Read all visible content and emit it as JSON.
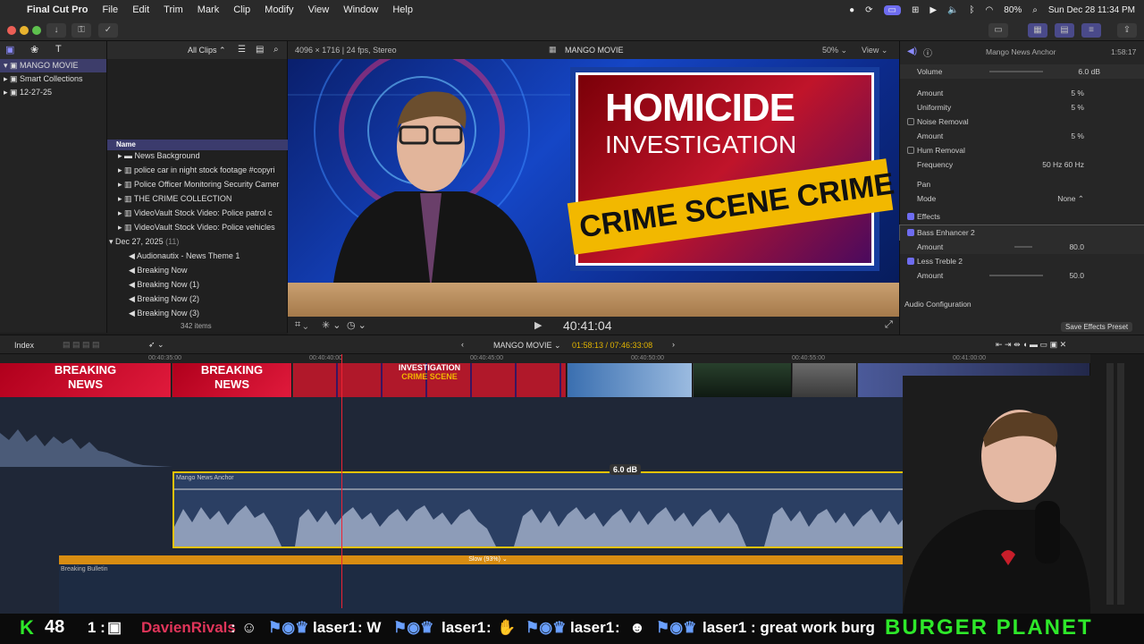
{
  "menubar": {
    "app_name": "Final Cut Pro",
    "items": [
      "File",
      "Edit",
      "Trim",
      "Mark",
      "Clip",
      "Modify",
      "View",
      "Window",
      "Help"
    ],
    "battery": "80%",
    "datetime": "Sun Dec 28  11:34 PM"
  },
  "library": {
    "items": [
      {
        "label": "MANGO MOVIE"
      },
      {
        "label": "Smart Collections"
      },
      {
        "label": "12-27-25"
      }
    ]
  },
  "browser": {
    "filter": "All Clips",
    "column_name": "Name",
    "rows": [
      {
        "label": "News Background"
      },
      {
        "label": "police  car in night stock footage #copyri"
      },
      {
        "label": "Police Officer Monitoring Security Camer"
      },
      {
        "label": "THE CRIME COLLECTION"
      },
      {
        "label": "VideoVault Stock Video:   Police patrol c"
      },
      {
        "label": "VideoVault Stock Video:   Police vehicles"
      },
      {
        "label": "Dec 27, 2025"
      },
      {
        "label": "Audionautix - News Theme 1"
      },
      {
        "label": "Breaking Now"
      },
      {
        "label": "Breaking Now (1)"
      },
      {
        "label": "Breaking Now (2)"
      },
      {
        "label": "Breaking Now (3)"
      }
    ],
    "date_count": "(11)",
    "items_count": "342 items"
  },
  "viewer": {
    "format": "4096 × 1716 | 24 fps, Stereo",
    "title": "MANGO MOVIE",
    "zoom": "50%",
    "view_label": "View",
    "timecode": "40:41:04",
    "card_line1": "HOMICIDE",
    "card_line2": "INVESTIGATION",
    "tape_text": "CRIME SCENE  CRIME SCENE"
  },
  "inspector": {
    "clip_name": "Mango News Anchor",
    "duration": "1:58:17",
    "volume_label": "Volume",
    "volume_value": "6.0 dB",
    "rows": [
      {
        "label": "Amount",
        "value": "5  %"
      },
      {
        "label": "Uniformity",
        "value": "5  %"
      },
      {
        "label": "Noise Removal",
        "value": ""
      },
      {
        "label": "Amount",
        "value": "5  %"
      },
      {
        "label": "Hum Removal",
        "value": ""
      },
      {
        "label": "Frequency",
        "value": "50 Hz     60 Hz"
      },
      {
        "label": "Pan",
        "value": ""
      },
      {
        "label": "Mode",
        "value": "None ⌃"
      },
      {
        "label": "Effects",
        "value": ""
      },
      {
        "label": "Bass Enhancer 2",
        "value": ""
      },
      {
        "label": "Amount",
        "value": "80.0"
      },
      {
        "label": "Less Treble 2",
        "value": ""
      },
      {
        "label": "Amount",
        "value": "50.0"
      },
      {
        "label": "Audio Configuration",
        "value": ""
      }
    ],
    "save_preset": "Save Effects Preset"
  },
  "timeline": {
    "index_label": "Index",
    "project": "MANGO MOVIE",
    "timecode": "01:58:13 / 07:46:33:08",
    "ruler_marks": [
      "00:40:35:00",
      "00:40:40:00",
      "00:40:45:00",
      "00:40:50:00",
      "00:40:55:00",
      "00:41:00:00"
    ],
    "audio_clip_label": "Mango News Anchor",
    "volume_tip": "6.0 dB",
    "speed_label": "Slow (93%) ⌄",
    "bulletin_label": "Breaking Bulletin"
  },
  "ticker": {
    "score": "48",
    "text1": "1 :",
    "user1": "DavienRivals",
    "user2": "laser1",
    "msg2": ": W",
    "user3": "laser1",
    "user4": "laser1",
    "user5": "laser1",
    "msg5": ": great work burg",
    "brand": "BURGER PLANET"
  },
  "colors": {
    "accent": "#6e6cf0",
    "selection": "#3b3b6d",
    "clip_yellow": "#e6c200",
    "orange": "#d88d12"
  }
}
